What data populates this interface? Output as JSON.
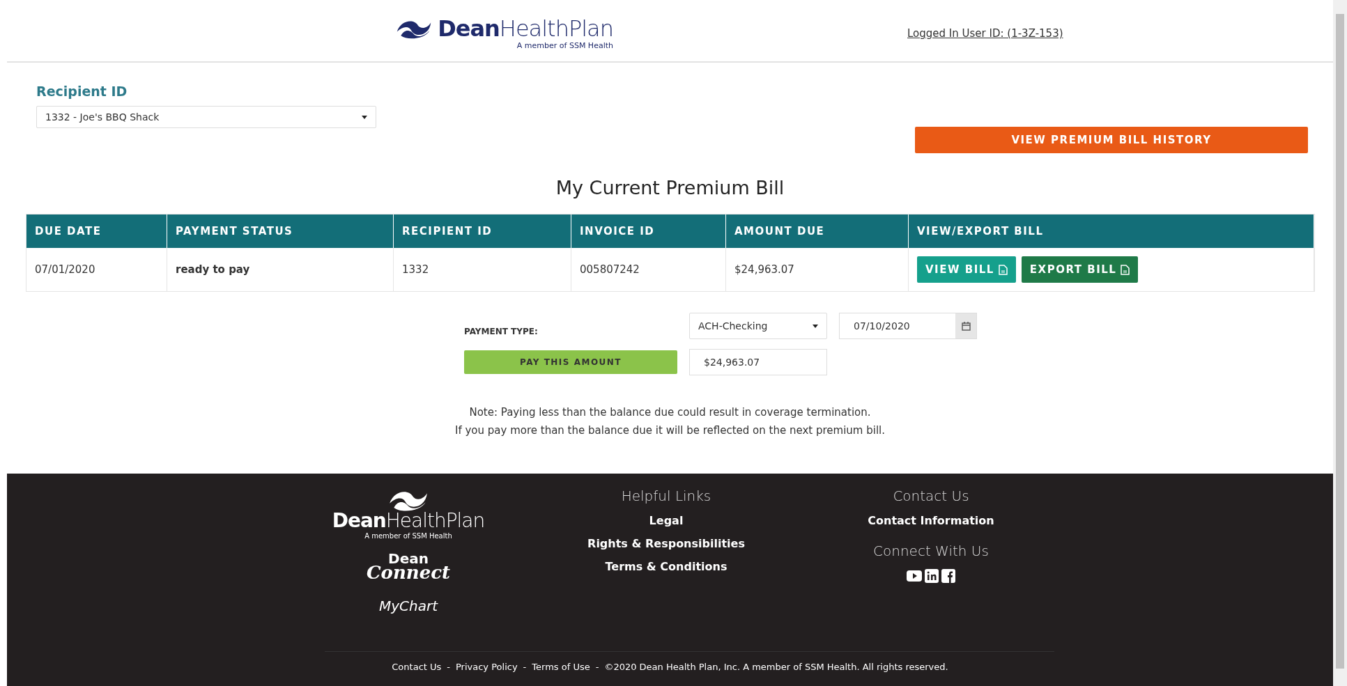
{
  "header": {
    "logo": {
      "bold": "Dean",
      "light": "HealthPlan",
      "tagline": "A member of SSM Health"
    },
    "user_link": "Logged In User ID: (1-3Z-153)"
  },
  "recipient": {
    "label": "Recipient ID",
    "value": "1332 - Joe's BBQ Shack"
  },
  "history_button": "VIEW PREMIUM BILL HISTORY",
  "title": "My Current Premium Bill",
  "table": {
    "columns": [
      "DUE DATE",
      "PAYMENT STATUS",
      "RECIPIENT ID",
      "INVOICE ID",
      "AMOUNT DUE",
      "VIEW/EXPORT BILL"
    ],
    "rows": [
      {
        "cells": [
          "07/01/2020",
          "ready to pay",
          "1332",
          "005807242",
          "$24,963.07"
        ],
        "actions": [
          {
            "kind": "view",
            "label": "VIEW BILL"
          },
          {
            "kind": "export",
            "label": "EXPORT BILL"
          }
        ]
      }
    ]
  },
  "payment": {
    "label": "PAYMENT TYPE:",
    "type": "ACH-Checking",
    "date": "07/10/2020",
    "pay_button": "PAY THIS AMOUNT",
    "amount": "$24,963.07"
  },
  "notes": [
    "Note: Paying less than the balance due could result in coverage termination.",
    "If you pay more than the balance due it will be reflected on the next premium bill."
  ],
  "footer": {
    "logo": {
      "bold": "Dean",
      "light": "HealthPlan",
      "tagline": "A member of SSM Health"
    },
    "connect_logo": {
      "top": "Dean",
      "bottom": "Connect"
    },
    "mychart": "MyChart",
    "helpful_heading": "Helpful Links",
    "helpful_links": [
      "Legal",
      "Rights & Responsibilities",
      "Terms & Conditions"
    ],
    "contact_heading": "Contact Us",
    "contact_links": [
      "Contact Information"
    ],
    "connect_heading": "Connect With Us",
    "social": [
      {
        "kind": "youtube"
      },
      {
        "kind": "linkedin"
      },
      {
        "kind": "facebook"
      }
    ],
    "bottom_links": [
      "Contact Us",
      "Privacy Policy",
      "Terms of Use"
    ],
    "bottom_separator": "-",
    "copyright": "©2020 Dean Health Plan, Inc. A member of SSM Health. All rights reserved."
  }
}
